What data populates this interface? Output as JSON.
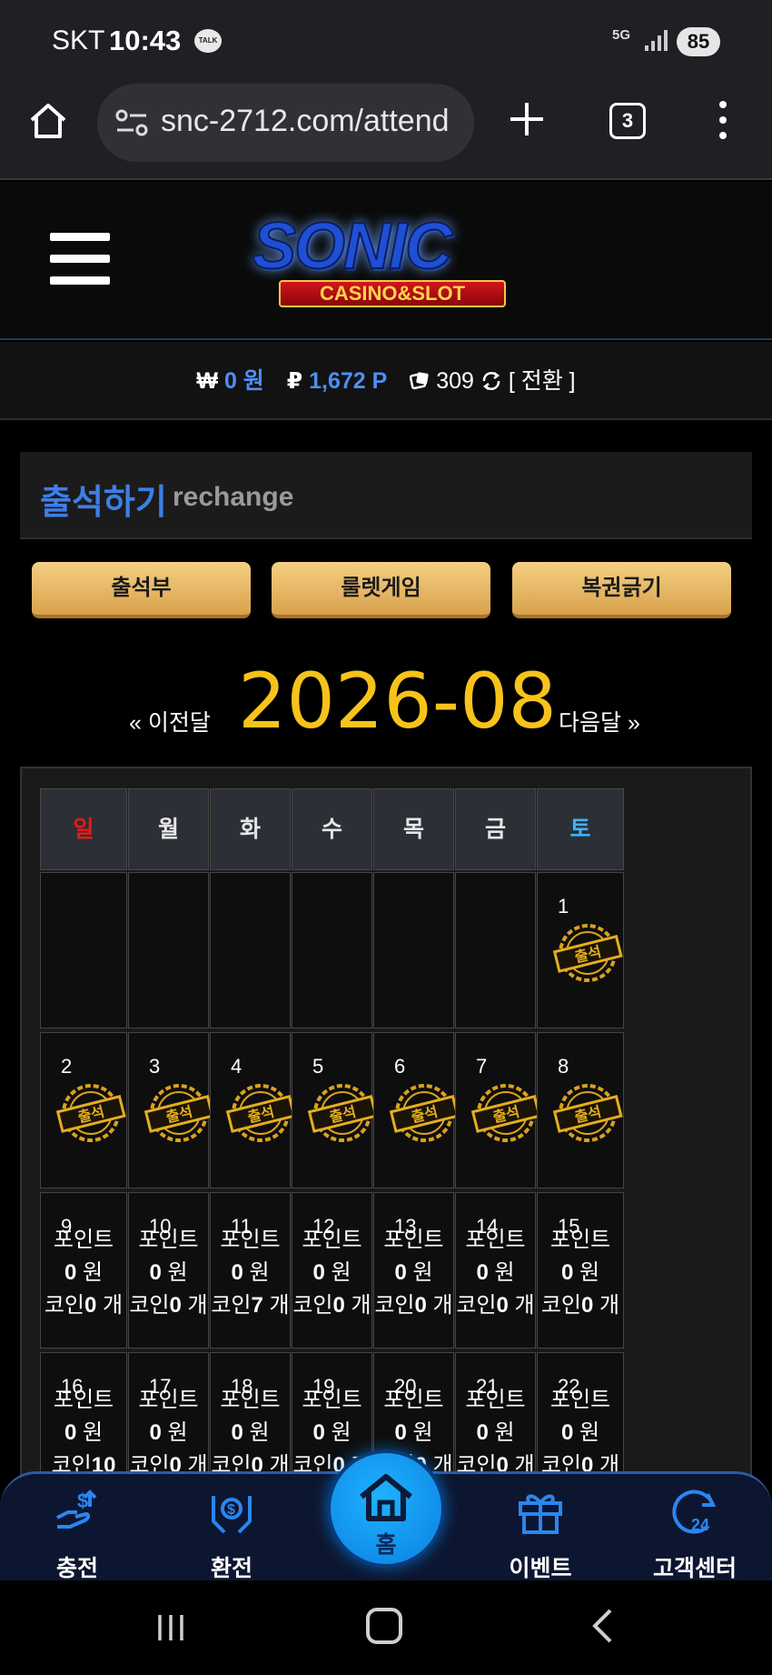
{
  "status_bar": {
    "carrier": "SKT",
    "time": "10:43",
    "talk_badge": "TALK",
    "network": "5G",
    "battery": "85"
  },
  "browser": {
    "url": "snc-2712.com/attend",
    "tab_count": "3"
  },
  "site": {
    "logo_title": "SONIC",
    "logo_subtitle": "CASINO&SLOT"
  },
  "balance": {
    "money_symbol": "₩",
    "money_value": "0 원",
    "point_symbol": "₽",
    "point_value": "1,672 P",
    "coin_value": "309",
    "convert_label": "[ 전환 ]"
  },
  "section": {
    "title": "출석하기",
    "subtitle": "rechange"
  },
  "tabs": [
    {
      "label": "출석부"
    },
    {
      "label": "룰렛게임"
    },
    {
      "label": "복권긁기"
    }
  ],
  "calendar": {
    "prev_label": "« 이전달",
    "month": "2026-08",
    "next_label": "다음달 »",
    "weekdays": [
      {
        "label": "일",
        "color": "#e31b1b"
      },
      {
        "label": "월",
        "color": "#e6e6e6"
      },
      {
        "label": "화",
        "color": "#e6e6e6"
      },
      {
        "label": "수",
        "color": "#e6e6e6"
      },
      {
        "label": "목",
        "color": "#e6e6e6"
      },
      {
        "label": "금",
        "color": "#e6e6e6"
      },
      {
        "label": "토",
        "color": "#3fb2ff"
      }
    ],
    "stamp_label": "출석",
    "point_label": "포인트",
    "won_unit": "원",
    "coin_label": "코인",
    "coin_unit": "개",
    "week1": [
      {
        "day": ""
      },
      {
        "day": ""
      },
      {
        "day": ""
      },
      {
        "day": ""
      },
      {
        "day": ""
      },
      {
        "day": ""
      },
      {
        "day": "1",
        "attended": true
      }
    ],
    "week2": [
      {
        "day": "2",
        "attended": true
      },
      {
        "day": "3",
        "attended": true
      },
      {
        "day": "4",
        "attended": true
      },
      {
        "day": "5",
        "attended": true
      },
      {
        "day": "6",
        "attended": true
      },
      {
        "day": "7",
        "attended": true
      },
      {
        "day": "8",
        "attended": true
      }
    ],
    "week3": [
      {
        "day": "9",
        "won": "0",
        "coin": "0"
      },
      {
        "day": "10",
        "won": "0",
        "coin": "0"
      },
      {
        "day": "11",
        "won": "0",
        "coin": "7"
      },
      {
        "day": "12",
        "won": "0",
        "coin": "0"
      },
      {
        "day": "13",
        "won": "0",
        "coin": "0"
      },
      {
        "day": "14",
        "won": "0",
        "coin": "0"
      },
      {
        "day": "15",
        "won": "0",
        "coin": "0"
      }
    ],
    "week4": [
      {
        "day": "16",
        "won": "0",
        "coin": "10"
      },
      {
        "day": "17",
        "won": "0",
        "coin": "0"
      },
      {
        "day": "18",
        "won": "0",
        "coin": "0"
      },
      {
        "day": "19",
        "won": "0",
        "coin": "0"
      },
      {
        "day": "20",
        "won": "0",
        "coin": "0"
      },
      {
        "day": "21",
        "won": "0",
        "coin": "0"
      },
      {
        "day": "22",
        "won": "0",
        "coin": "0"
      }
    ]
  },
  "bottom_nav": {
    "charge": "충전",
    "exchange": "환전",
    "home": "홈",
    "event": "이벤트",
    "support": "고객센터"
  }
}
